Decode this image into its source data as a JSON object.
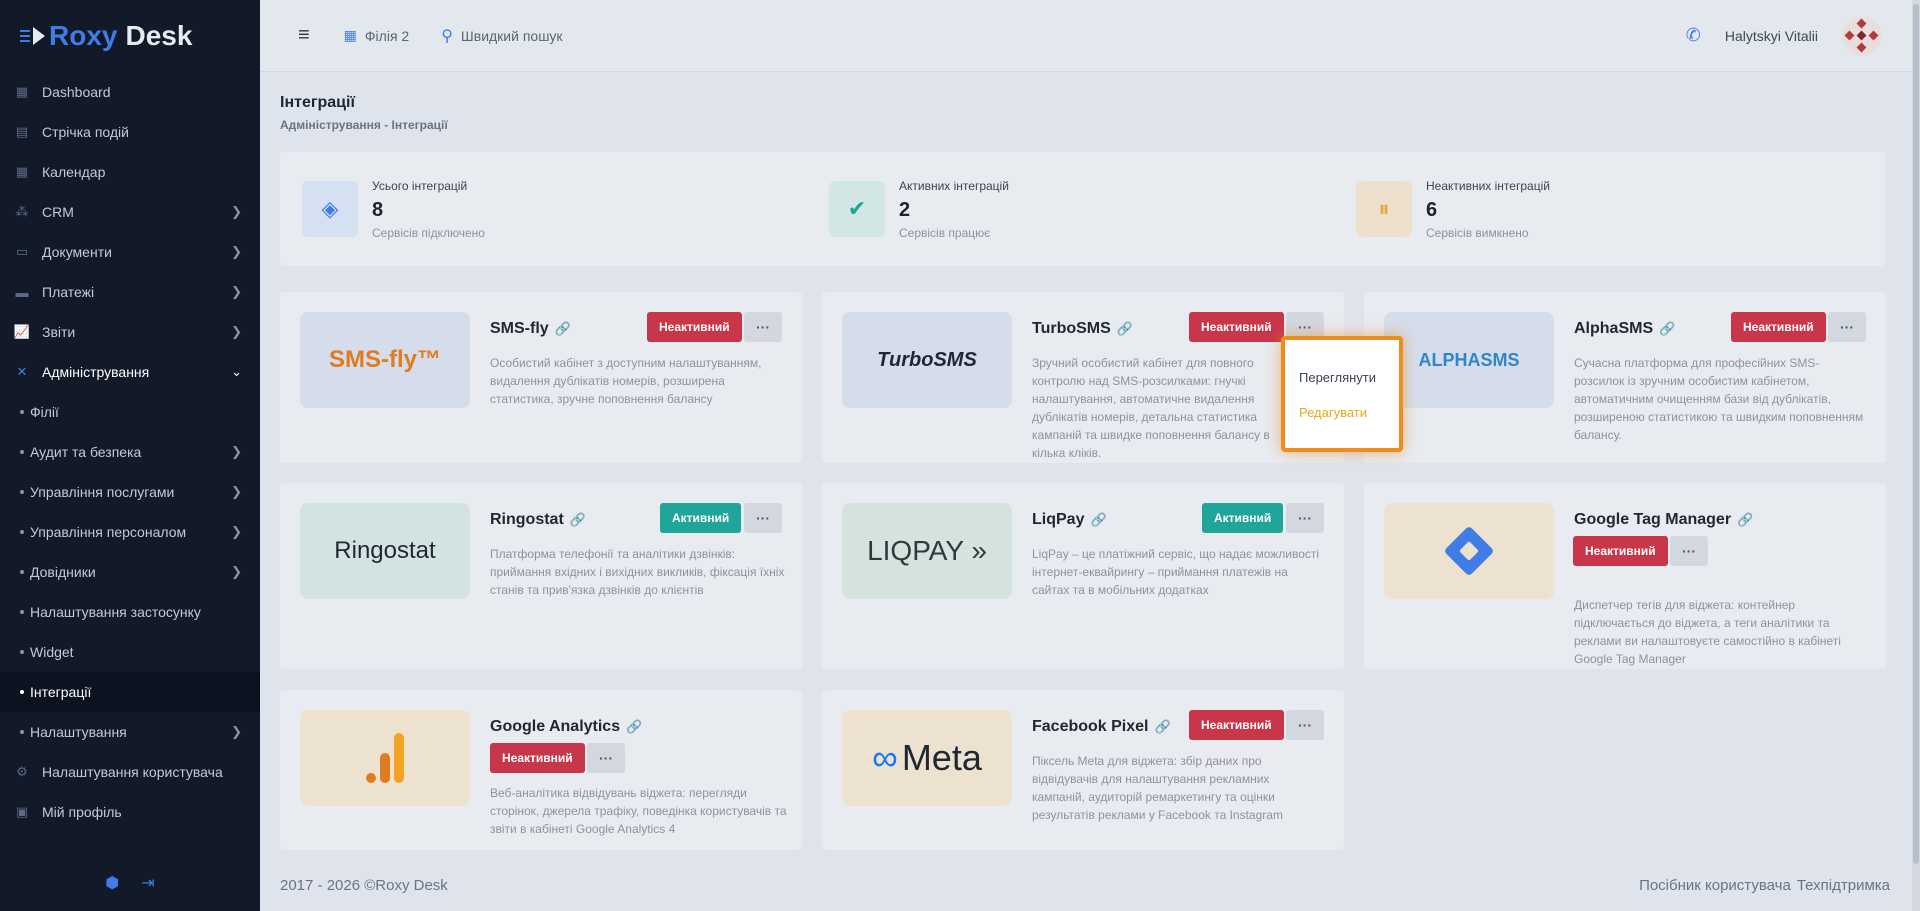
{
  "app": {
    "logo_part1": "Roxy",
    "logo_part2": "Desk"
  },
  "sidebar": {
    "items": [
      {
        "label": "Dashboard",
        "icon": "dashboard-icon"
      },
      {
        "label": "Стрічка подій",
        "icon": "feed-icon"
      },
      {
        "label": "Календар",
        "icon": "calendar-icon"
      },
      {
        "label": "CRM",
        "icon": "crm-icon"
      },
      {
        "label": "Документи",
        "icon": "document-icon"
      },
      {
        "label": "Платежі",
        "icon": "payment-icon"
      },
      {
        "label": "Звіти",
        "icon": "chart-icon"
      },
      {
        "label": "Адміністрування",
        "icon": "tools-icon"
      },
      {
        "label": "Філії"
      },
      {
        "label": "Аудит та безпека"
      },
      {
        "label": "Управління послугами"
      },
      {
        "label": "Управління персоналом"
      },
      {
        "label": "Довідники"
      },
      {
        "label": "Налаштування застосунку"
      },
      {
        "label": "Widget"
      },
      {
        "label": "Інтеграції"
      },
      {
        "label": "Налаштування"
      },
      {
        "label": "Налаштування користувача",
        "icon": "user-settings-icon"
      },
      {
        "label": "Мій профіль",
        "icon": "profile-icon"
      }
    ]
  },
  "topbar": {
    "branch": "Філія 2",
    "search": "Швидкий пошук",
    "user": "Halytskyi Vitalii"
  },
  "page": {
    "title": "Інтеграції",
    "breadcrumb": "Адміністрування - Інтеграції"
  },
  "stats": [
    {
      "label": "Усього інтеграцій",
      "value": "8",
      "sub": "Сервісів підключено"
    },
    {
      "label": "Активних інтеграцій",
      "value": "2",
      "sub": "Сервісів працює"
    },
    {
      "label": "Неактивних інтеграцій",
      "value": "6",
      "sub": "Сервісів вимкнено"
    }
  ],
  "cards": [
    {
      "name": "SMS-fly",
      "logo": "SMS-fly™",
      "status": "Неактивний",
      "desc": "Особистий кабінет з доступним налаштуванням, видалення дублікатів номерів, розширена статистика, зручне поповнення балансу"
    },
    {
      "name": "TurboSMS",
      "logo": "TurboSMS",
      "status": "Неактивний",
      "desc": "Зручний особистий кабінет для повного контролю над SMS-розсилками: гнучкі налаштування, автоматичне видалення дублікатів номерів, детальна статистика кампаній та швидке поповнення балансу в кілька кліків."
    },
    {
      "name": "AlphaSMS",
      "logo": "ALPHASMS",
      "status": "Неактивний",
      "desc": "Сучасна платформа для професійних SMS-розсилок із зручним особистим кабінетом, автоматичним очищенням бази від дублікатів, розширеною статистикою та швидким поповненням балансу."
    },
    {
      "name": "Ringostat",
      "logo": "Ringostat",
      "status": "Активний",
      "desc": "Платформа телефонії та аналітики дзвінків: приймання вхідних і вихідних викликів, фіксація їхніх станів та прив'язка дзвінків до клієнтів"
    },
    {
      "name": "LiqPay",
      "logo": "LIQPAY »",
      "status": "Активний",
      "desc": "LiqPay – це платіжний сервіс, що надає можливості інтернет-еквайрингу – приймання платежів на сайтах та в мобільних додатках"
    },
    {
      "name": "Google Tag Manager",
      "status": "Неактивний",
      "desc": "Диспетчер тегів для віджета: контейнер підключається до віджета, а теги аналітики та реклами ви налаштовуєте самостійно в кабінеті Google Tag Manager"
    },
    {
      "name": "Google Analytics",
      "status": "Неактивний",
      "desc": "Веб-аналітика відвідувань віджета: перегляди сторінок, джерела трафіку, поведінка користувачів та звіти в кабінеті Google Analytics 4"
    },
    {
      "name": "Facebook Pixel",
      "logo": "Meta",
      "status": "Неактивний",
      "desc": "Піксель Meta для віджета: збір даних про відвідувачів для налаштування рекламних кампаній, аудиторій ремаркетингу та оцінки результатів реклами у Facebook та Instagram"
    }
  ],
  "dropdown": {
    "view": "Переглянути",
    "edit": "Редагувати"
  },
  "footer": {
    "copyright": "2017 - 2026 ©Roxy Desk",
    "guide": "Посібник користувача",
    "support": "Техпідтримка"
  },
  "colors": {
    "sidebar": "#121a2a",
    "accent": "#3f7ce6",
    "inactive": "#c8364a",
    "active": "#1fa59a",
    "highlight": "#ef8c1e"
  }
}
